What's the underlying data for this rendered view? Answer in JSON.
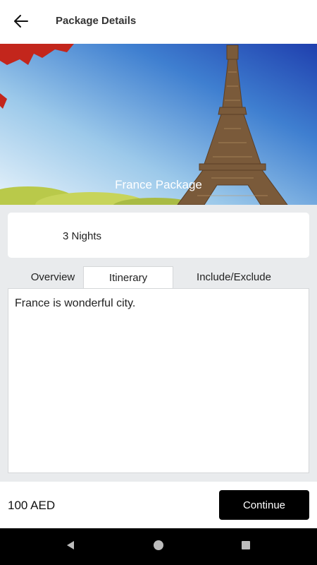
{
  "header": {
    "title": "Package Details",
    "back_icon": "arrow-left-icon"
  },
  "hero": {
    "caption": "France Package"
  },
  "package": {
    "nights": "3 Nights"
  },
  "tabs": [
    {
      "label": "Overview",
      "active": false
    },
    {
      "label": "Itinerary",
      "active": true
    },
    {
      "label": "Include/Exclude",
      "active": false
    }
  ],
  "content": {
    "text": "France is wonderful city."
  },
  "footer": {
    "price": "100 AED",
    "continue_label": "Continue"
  },
  "system_nav": {
    "back_icon": "triangle-back-icon",
    "home_icon": "circle-home-icon",
    "recents_icon": "square-recents-icon"
  },
  "colors": {
    "accent": "#000000",
    "background": "#e9ebed"
  }
}
